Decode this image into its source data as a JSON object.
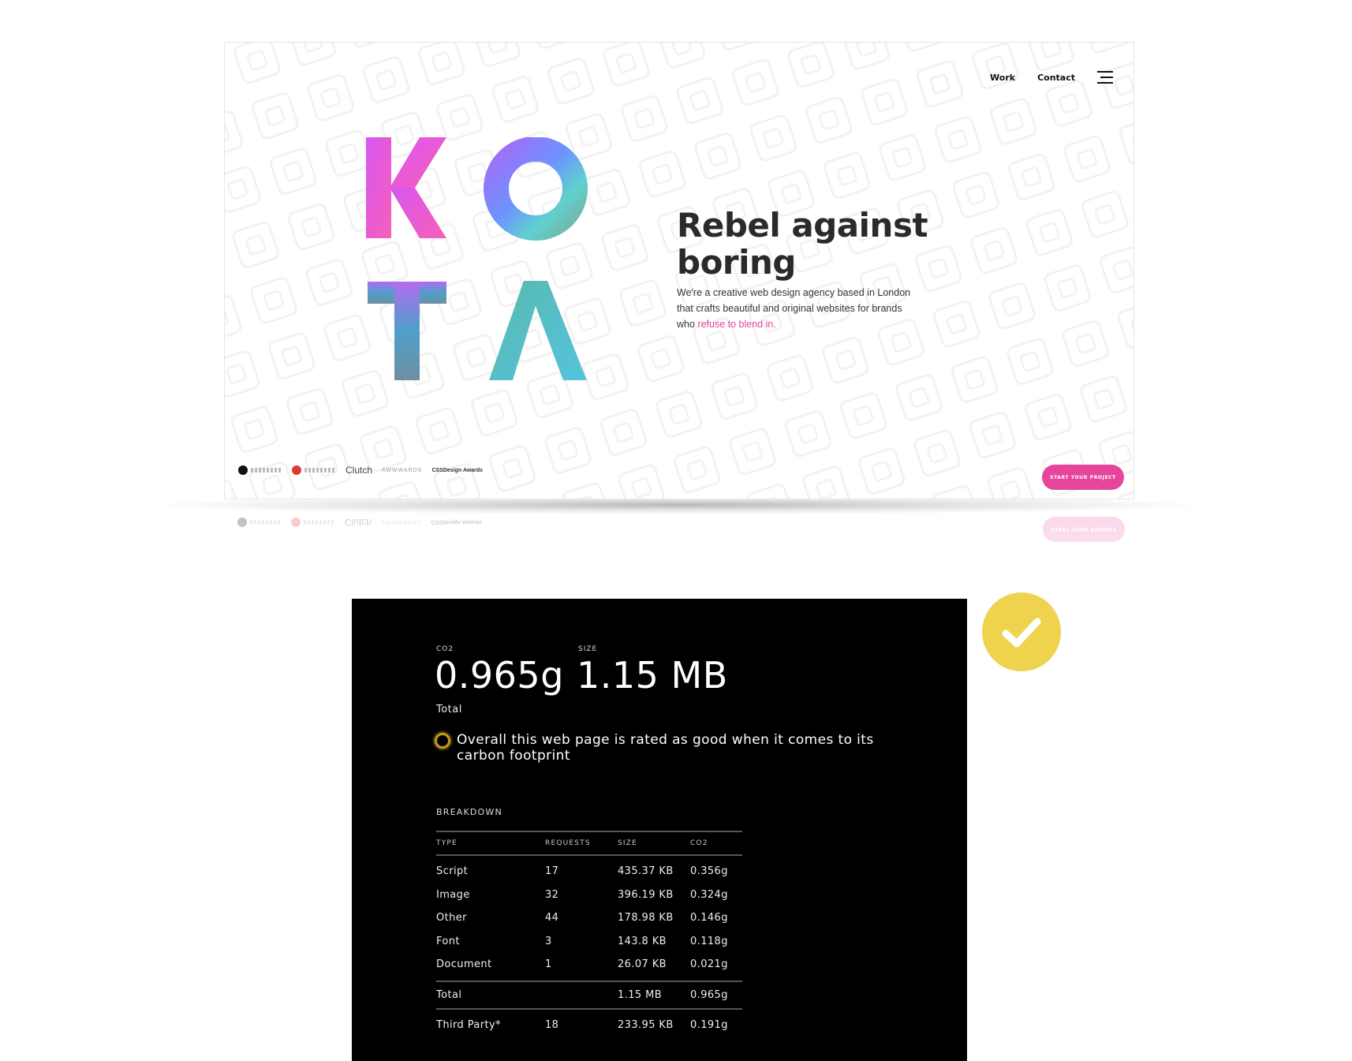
{
  "site": {
    "nav": {
      "work_label": "Work",
      "contact_label": "Contact"
    },
    "logo_letters": [
      "K",
      "O",
      "T",
      "A"
    ],
    "hero": {
      "title": "Rebel against boring",
      "description_prefix": "We're a creative web design agency based in London that crafts beautiful and original websites for brands who",
      "description_accent": "refuse to blend in."
    },
    "awards": [
      {
        "name": "Digital Agency Network",
        "style": "dark"
      },
      {
        "name": "The Drum Recommended",
        "style": "red"
      },
      {
        "name": "Clutch",
        "style": "text"
      },
      {
        "name": "AWWWARDS",
        "style": "text"
      },
      {
        "name": "CSSDesign Awards",
        "style": "text"
      }
    ],
    "cta_label": "START YOUR PROJECT",
    "colors": {
      "accent": "#e7449c",
      "logo_gradient": [
        "#e84ad8",
        "#7b8cff",
        "#54c8d6",
        "#6fa6a8"
      ]
    }
  },
  "carbon": {
    "co2_label": "CO2",
    "co2_value": "0.965g",
    "size_label": "SIZE",
    "size_value": "1.15 MB",
    "total_label": "Total",
    "rating_text": "Overall this web page is rated as good when it comes to its carbon footprint",
    "breakdown_title": "BREAKDOWN",
    "columns": [
      "TYPE",
      "REQUESTS",
      "SIZE",
      "CO2"
    ],
    "rows": [
      {
        "type": "Script",
        "requests": "17",
        "size": "435.37 KB",
        "co2": "0.356g"
      },
      {
        "type": "Image",
        "requests": "32",
        "size": "396.19 KB",
        "co2": "0.324g"
      },
      {
        "type": "Other",
        "requests": "44",
        "size": "178.98 KB",
        "co2": "0.146g"
      },
      {
        "type": "Font",
        "requests": "3",
        "size": "143.8 KB",
        "co2": "0.118g"
      },
      {
        "type": "Document",
        "requests": "1",
        "size": "26.07 KB",
        "co2": "0.021g"
      }
    ],
    "total_row": {
      "type": "Total",
      "requests": "",
      "size": "1.15 MB",
      "co2": "0.965g"
    },
    "third_party_row": {
      "type": "Third Party*",
      "requests": "18",
      "size": "233.95 KB",
      "co2": "0.191g"
    },
    "badge": {
      "icon": "checkmark-icon",
      "color": "#efd34f"
    }
  }
}
